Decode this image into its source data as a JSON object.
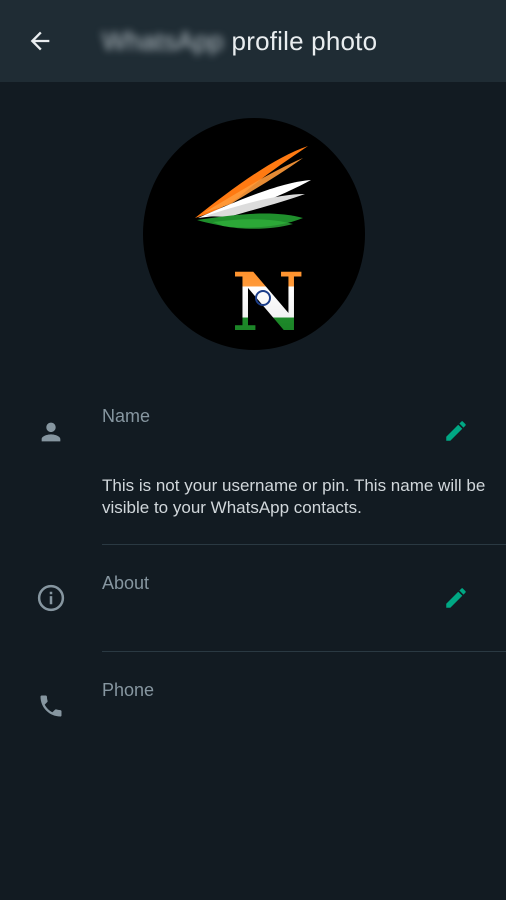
{
  "app_bar": {
    "app_name": "WhatsApp",
    "title": "profile photo"
  },
  "name_section": {
    "label": "Name",
    "value": "",
    "helper": "This is not your username or pin. This name will be visible to your WhatsApp contacts."
  },
  "about_section": {
    "label": "About",
    "value": ""
  },
  "phone_section": {
    "label": "Phone",
    "value": ""
  },
  "icons": {
    "back": "arrow-left-icon",
    "name": "person-icon",
    "about": "info-icon",
    "phone": "phone-icon",
    "edit": "pencil-icon"
  },
  "colors": {
    "background": "#121b22",
    "app_bar": "#1f2c34",
    "accent": "#00a884",
    "label": "#8696a0",
    "text": "#e9edef"
  }
}
